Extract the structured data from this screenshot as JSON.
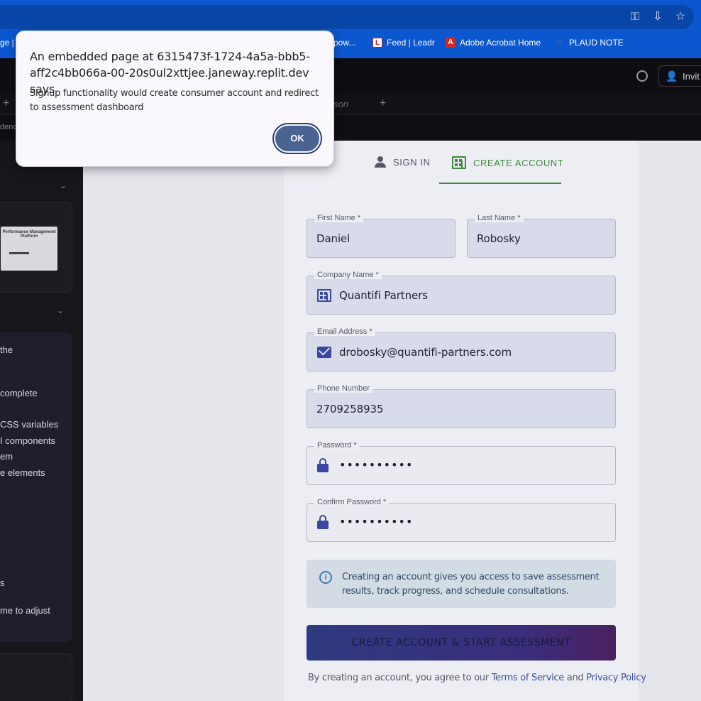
{
  "browser": {
    "bookmarks": [
      {
        "label": "ge |"
      },
      {
        "label": "pow..."
      },
      {
        "label": "Feed | Leadr"
      },
      {
        "label": "Adobe Acrobat Home"
      },
      {
        "label": "PLAUD NOTE"
      }
    ],
    "icons": [
      "key-icon",
      "install-icon",
      "star-icon"
    ]
  },
  "replit": {
    "invite_label": "Invit",
    "tab_ghost": "son",
    "crumb": "dence"
  },
  "sidebar": {
    "thumb_title": "Performance Management Platform",
    "lines": [
      "the",
      "complete",
      "CSS variables",
      "I components",
      "em",
      "e elements",
      "s",
      "me to adjust"
    ]
  },
  "auth": {
    "signin_tab": "SIGN IN",
    "create_tab": "CREATE ACCOUNT"
  },
  "form": {
    "first_name": {
      "label": "First Name *",
      "value": "Daniel"
    },
    "last_name": {
      "label": "Last Name *",
      "value": "Robosky"
    },
    "company": {
      "label": "Company Name *",
      "value": "Quantifi Partners"
    },
    "email": {
      "label": "Email Address *",
      "value": "drobosky@quantifi-partners.com"
    },
    "phone": {
      "label": "Phone Number",
      "value": "2709258935"
    },
    "password": {
      "label": "Password *",
      "value": "••••••••••"
    },
    "confirm": {
      "label": "Confirm Password *",
      "value": "••••••••••"
    }
  },
  "info_text": "Creating an account gives you access to save assessment results, track progress, and schedule consultations.",
  "submit_label": "CREATE ACCOUNT & START ASSESSMENT",
  "terms": {
    "prefix": "By creating an account, you agree to our ",
    "tos": "Terms of Service",
    "and": " and ",
    "privacy": "Privacy Policy"
  },
  "dialog": {
    "title": "An embedded page at 6315473f-1724-4a5a-bbb5-aff2c4bb066a-00-20s0ul2xttjee.janeway.replit.dev says",
    "message": "Signup functionality would create consumer account and redirect to assessment dashboard",
    "ok_label": "OK"
  },
  "colors": {
    "browser_blue": "#0b57d0",
    "accent_green": "#3f8a3b",
    "field_icon": "#3a47a0",
    "dialog_ok": "#4a6391"
  }
}
